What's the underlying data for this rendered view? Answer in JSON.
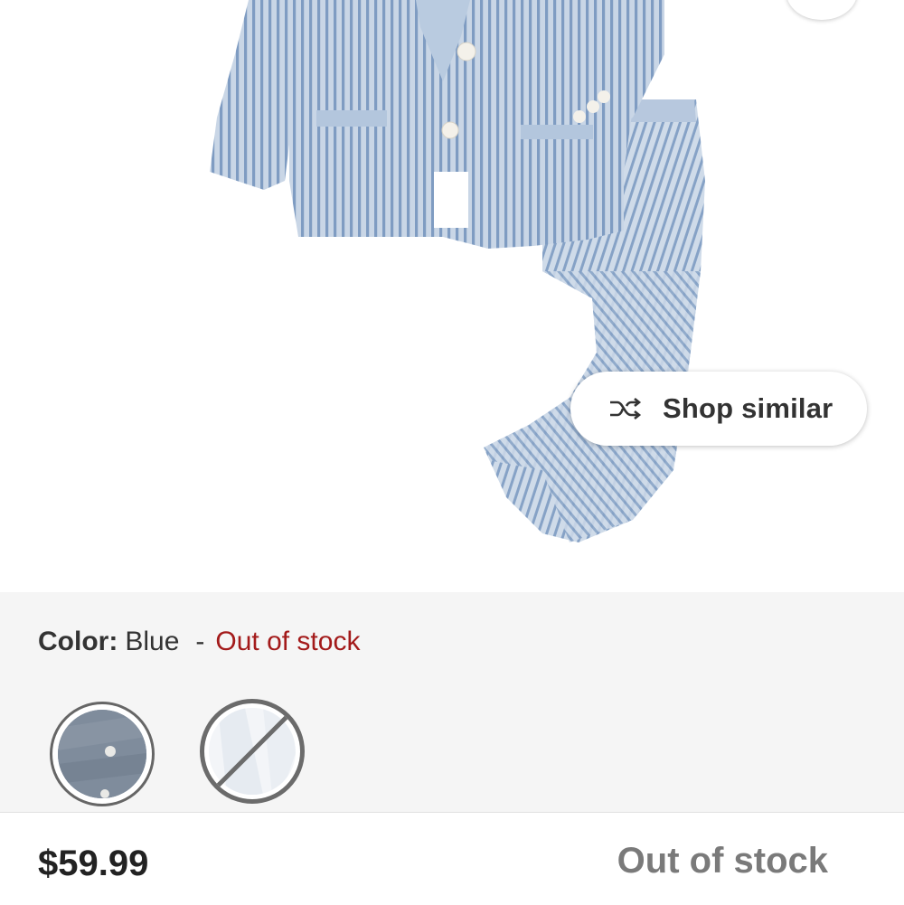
{
  "product": {
    "image_alt": "Blue seersucker suit set",
    "shop_similar_label": "Shop similar"
  },
  "variant": {
    "color_label": "Color:",
    "color_value": "Blue",
    "separator": "-",
    "availability": "Out of stock",
    "swatches": [
      {
        "name": "Blue",
        "selected": true,
        "available": true
      },
      {
        "name": "White",
        "selected": false,
        "available": false
      }
    ]
  },
  "purchase_bar": {
    "price": "$59.99",
    "status": "Out of stock"
  },
  "colors": {
    "availability_red": "#a31a1a",
    "status_gray": "#7a7a7a",
    "panel_bg": "#f5f5f5"
  },
  "icons": {
    "shop_similar": "shuffle-icon",
    "favorite": "favorite-button"
  }
}
